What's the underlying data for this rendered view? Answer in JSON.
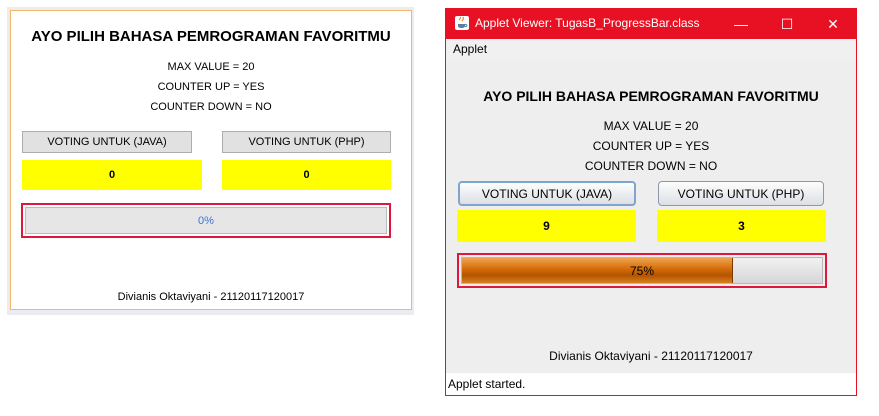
{
  "preview": {
    "title": "AYO PILIH BAHASA PEMROGRAMAN FAVORITMU",
    "max_value": "MAX VALUE = 20",
    "counter_up": "COUNTER UP = YES",
    "counter_down": "COUNTER DOWN = NO",
    "vote_java_label": "VOTING UNTUK (JAVA)",
    "vote_php_label": "VOTING UNTUK (PHP)",
    "java_count": "0",
    "php_count": "0",
    "progress_text": "0%",
    "progress_value": 0,
    "footer": "Divianis Oktaviyani - 21120117120017",
    "colors": {
      "count_bg": "#ffff00",
      "highlight": "#e0173c",
      "border": "#f5b86a"
    }
  },
  "window": {
    "title": "Applet Viewer: TugasB_ProgressBar.class",
    "icons": {
      "app": "java-icon",
      "minimize": "minimize-icon",
      "maximize": "maximize-icon",
      "close": "close-icon"
    },
    "minimize_glyph": "—",
    "maximize_glyph": "☐",
    "close_glyph": "✕",
    "menu": [
      "Applet"
    ],
    "status": "Applet started.",
    "colors": {
      "titlebar": "#e81123",
      "count_bg": "#ffff00",
      "progress_fill": "#d46a06",
      "highlight": "#e0173c"
    }
  },
  "applet": {
    "title": "AYO PILIH BAHASA PEMROGRAMAN FAVORITMU",
    "max_value": "MAX VALUE = 20",
    "counter_up": "COUNTER UP = YES",
    "counter_down": "COUNTER DOWN = NO",
    "vote_java_label": "VOTING UNTUK (JAVA)",
    "vote_php_label": "VOTING UNTUK (PHP)",
    "java_count": "9",
    "php_count": "3",
    "progress_text": "75%",
    "progress_value": 0.75,
    "footer": "Divianis Oktaviyani - 21120117120017"
  }
}
